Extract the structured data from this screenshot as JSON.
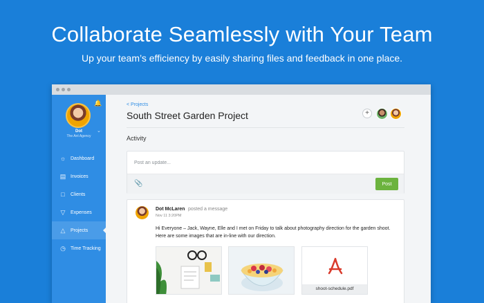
{
  "hero": {
    "title": "Collaborate Seamlessly with Your Team",
    "subtitle": "Up your team’s efficiency by easily sharing files and feedback in one place."
  },
  "colors": {
    "background": "#1a7fd9",
    "sidebar": "#2f8de4",
    "post_button": "#6cb33e"
  },
  "sidebar": {
    "user_name": "Dot",
    "user_org": "The Ant Agency",
    "items": [
      {
        "label": "Dashboard",
        "icon": "sun-icon"
      },
      {
        "label": "Invoices",
        "icon": "invoice-icon"
      },
      {
        "label": "Clients",
        "icon": "client-icon"
      },
      {
        "label": "Expenses",
        "icon": "expenses-icon"
      },
      {
        "label": "Projects",
        "icon": "flask-icon",
        "active": true
      },
      {
        "label": "Time Tracking",
        "icon": "clock-icon"
      }
    ]
  },
  "main": {
    "breadcrumb": "< Projects",
    "title": "South Street Garden Project",
    "section_title": "Activity",
    "composer": {
      "placeholder": "Post an update...",
      "post_label": "Post"
    },
    "post": {
      "author": "Dot McLaren",
      "action": "posted a message",
      "time": "Nov 11 3:20PM",
      "body": "Hi Everyone – Jack, Wayne, Elle and I met on Friday to talk about photography direction for the garden shoot. Here are some images that are in-line with our direction.",
      "attachment_name": "shoot-schedule.pdf"
    }
  }
}
